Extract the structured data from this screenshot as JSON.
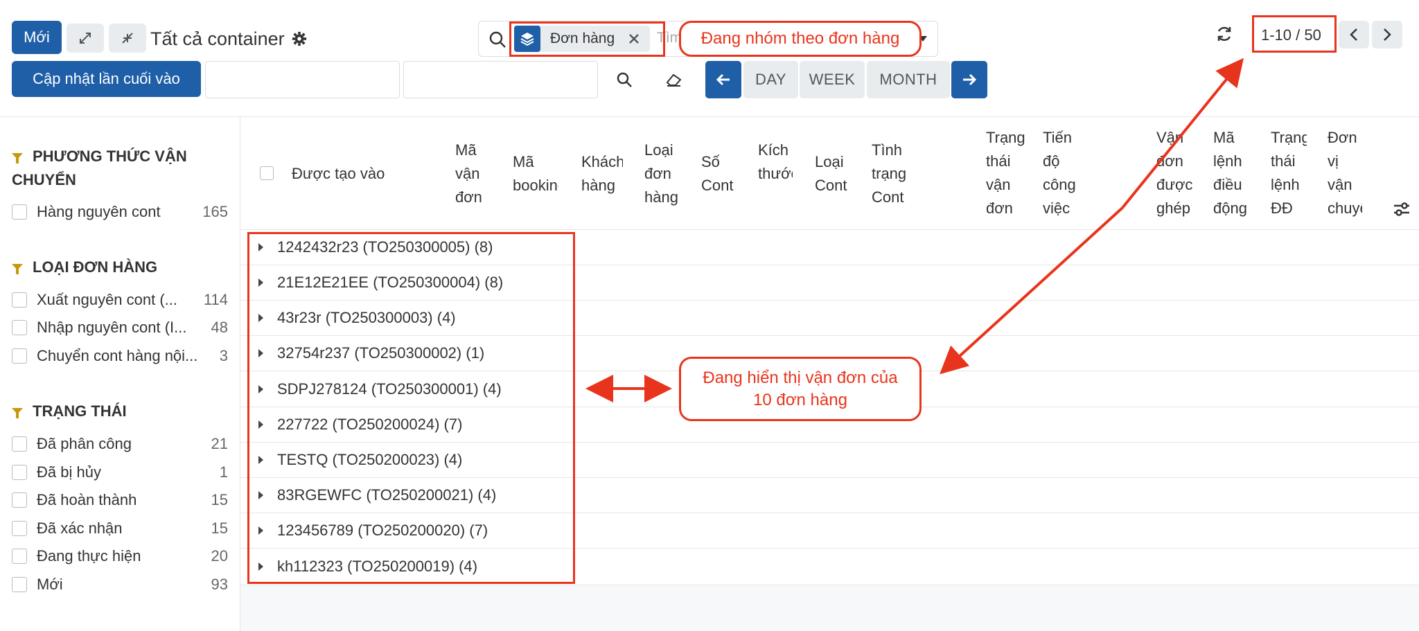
{
  "toolbar": {
    "new_label": "Mới",
    "view_title": "Tất cả container",
    "search_facet": "Đơn hàng",
    "search_placeholder": "Tìm",
    "pager": "1-10 / 50",
    "update_last_label": "Cập nhật lần cuối vào",
    "range_day": "DAY",
    "range_week": "WEEK",
    "range_month": "MONTH"
  },
  "annotations": {
    "grouping_note": "Đang nhóm theo đơn hàng",
    "display_note": "Đang hiển thị vận đơn của 10 đơn hàng",
    "accent_color": "#e8341c"
  },
  "sidebar": {
    "sections": [
      {
        "title": "PHƯƠNG THỨC VẬN CHUYỂN",
        "items": [
          {
            "label": "Hàng nguyên cont",
            "count": "165"
          }
        ]
      },
      {
        "title": "LOẠI ĐƠN HÀNG",
        "items": [
          {
            "label": "Xuất nguyên cont (...",
            "count": "114"
          },
          {
            "label": "Nhập nguyên cont (I...",
            "count": "48"
          },
          {
            "label": "Chuyển cont hàng nội...",
            "count": "3"
          }
        ]
      },
      {
        "title": "TRẠNG THÁI",
        "items": [
          {
            "label": "Đã phân công",
            "count": "21"
          },
          {
            "label": "Đã bị hủy",
            "count": "1"
          },
          {
            "label": "Đã hoàn thành",
            "count": "15"
          },
          {
            "label": "Đã xác nhận",
            "count": "15"
          },
          {
            "label": "Đang thực hiện",
            "count": "20"
          },
          {
            "label": "Mới",
            "count": "93"
          }
        ]
      }
    ]
  },
  "table": {
    "columns": [
      "Được tạo vào",
      "Mã vận đơn",
      "Mã booking",
      "Khách hàng",
      "Loại đơn hàng",
      "Số Cont",
      "Kích thước Cont",
      "Loại Cont",
      "Tình trạng Cont",
      "Trạng thái vận đơn",
      "Tiến độ công việc",
      "Vận đơn được ghép",
      "Mã lệnh điều động",
      "Trạng thái lệnh ĐĐ",
      "Đơn vị vận chuyển"
    ],
    "groups": [
      "1242432r23 (TO250300005) (8)",
      "21E12E21EE (TO250300004) (8)",
      "43r23r (TO250300003) (4)",
      "32754r237 (TO250300002) (1)",
      "SDPJ278124 (TO250300001) (4)",
      "227722 (TO250200024) (7)",
      "TESTQ (TO250200023) (4)",
      "83RGEWFC (TO250200021) (4)",
      "123456789 (TO250200020) (7)",
      "kh112323 (TO250200019) (4)"
    ]
  }
}
